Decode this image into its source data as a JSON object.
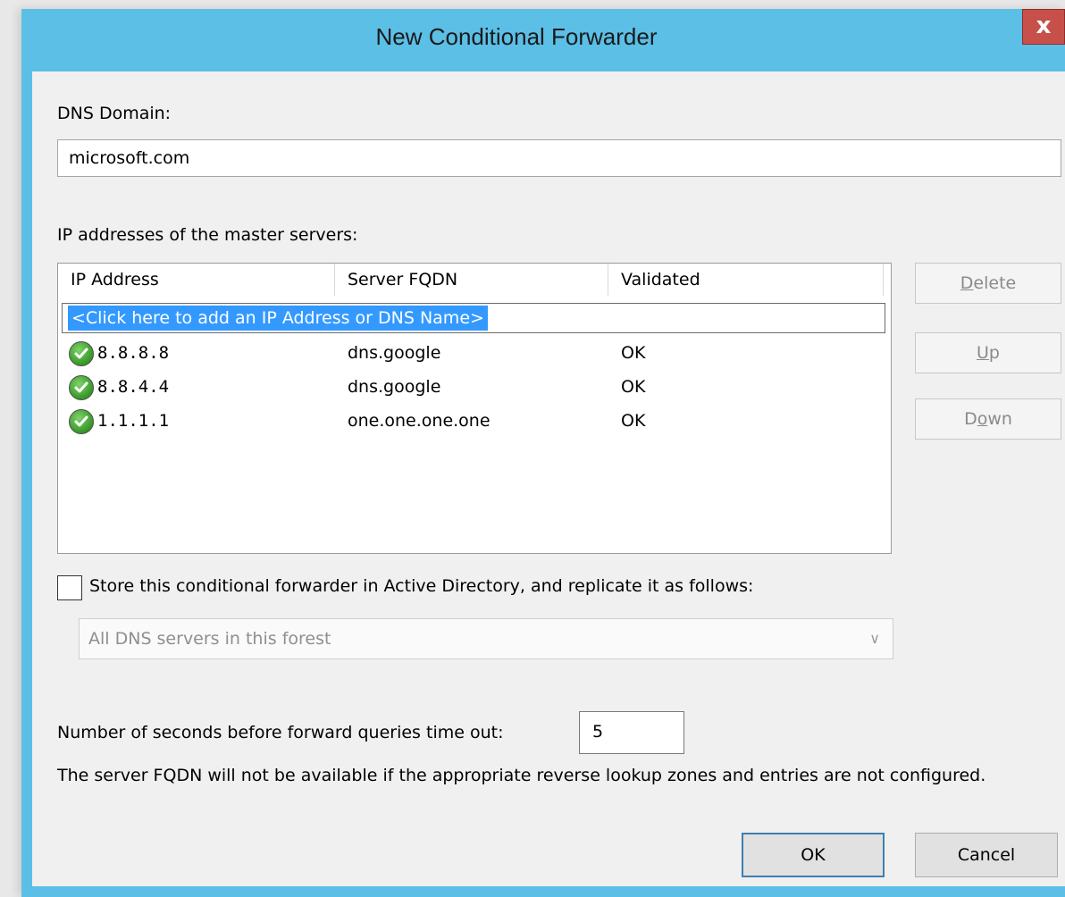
{
  "window": {
    "title": "New Conditional Forwarder",
    "close_glyph": "x"
  },
  "dns_domain": {
    "label": "DNS Domain:",
    "value": "microsoft.com"
  },
  "master_servers": {
    "label": "IP addresses of the master servers:",
    "columns": [
      "IP Address",
      "Server FQDN",
      "Validated"
    ],
    "add_row_text": "<Click here to add an IP Address or DNS Name>",
    "rows": [
      {
        "icon": "check-icon",
        "ip": "8.8.8.8",
        "fqdn": "dns.google",
        "validated": "OK"
      },
      {
        "icon": "check-icon",
        "ip": "8.8.4.4",
        "fqdn": "dns.google",
        "validated": "OK"
      },
      {
        "icon": "check-icon",
        "ip": "1.1.1.1",
        "fqdn": "one.one.one.one",
        "validated": "OK"
      }
    ]
  },
  "side_buttons": {
    "delete": {
      "pre": "",
      "accel": "D",
      "post": "elete"
    },
    "up": {
      "pre": "",
      "accel": "U",
      "post": "p"
    },
    "down": {
      "pre": "D",
      "accel": "o",
      "post": "wn"
    }
  },
  "store_ad": {
    "checked": false,
    "label": "Store this conditional forwarder in Active Directory, and replicate it as follows:"
  },
  "replication_scope": {
    "selected": "All DNS servers in this forest",
    "arrow": "∨"
  },
  "timeout": {
    "label": "Number of seconds before forward queries time out:",
    "value": "5"
  },
  "note": "The server FQDN will not be available if the appropriate reverse lookup zones and entries are not configured.",
  "buttons": {
    "ok": "OK",
    "cancel": "Cancel"
  },
  "colors": {
    "title_bar": "#5bbfe6",
    "close": "#c7504b",
    "selection": "#3399ff",
    "check": "#3a9b2a"
  }
}
